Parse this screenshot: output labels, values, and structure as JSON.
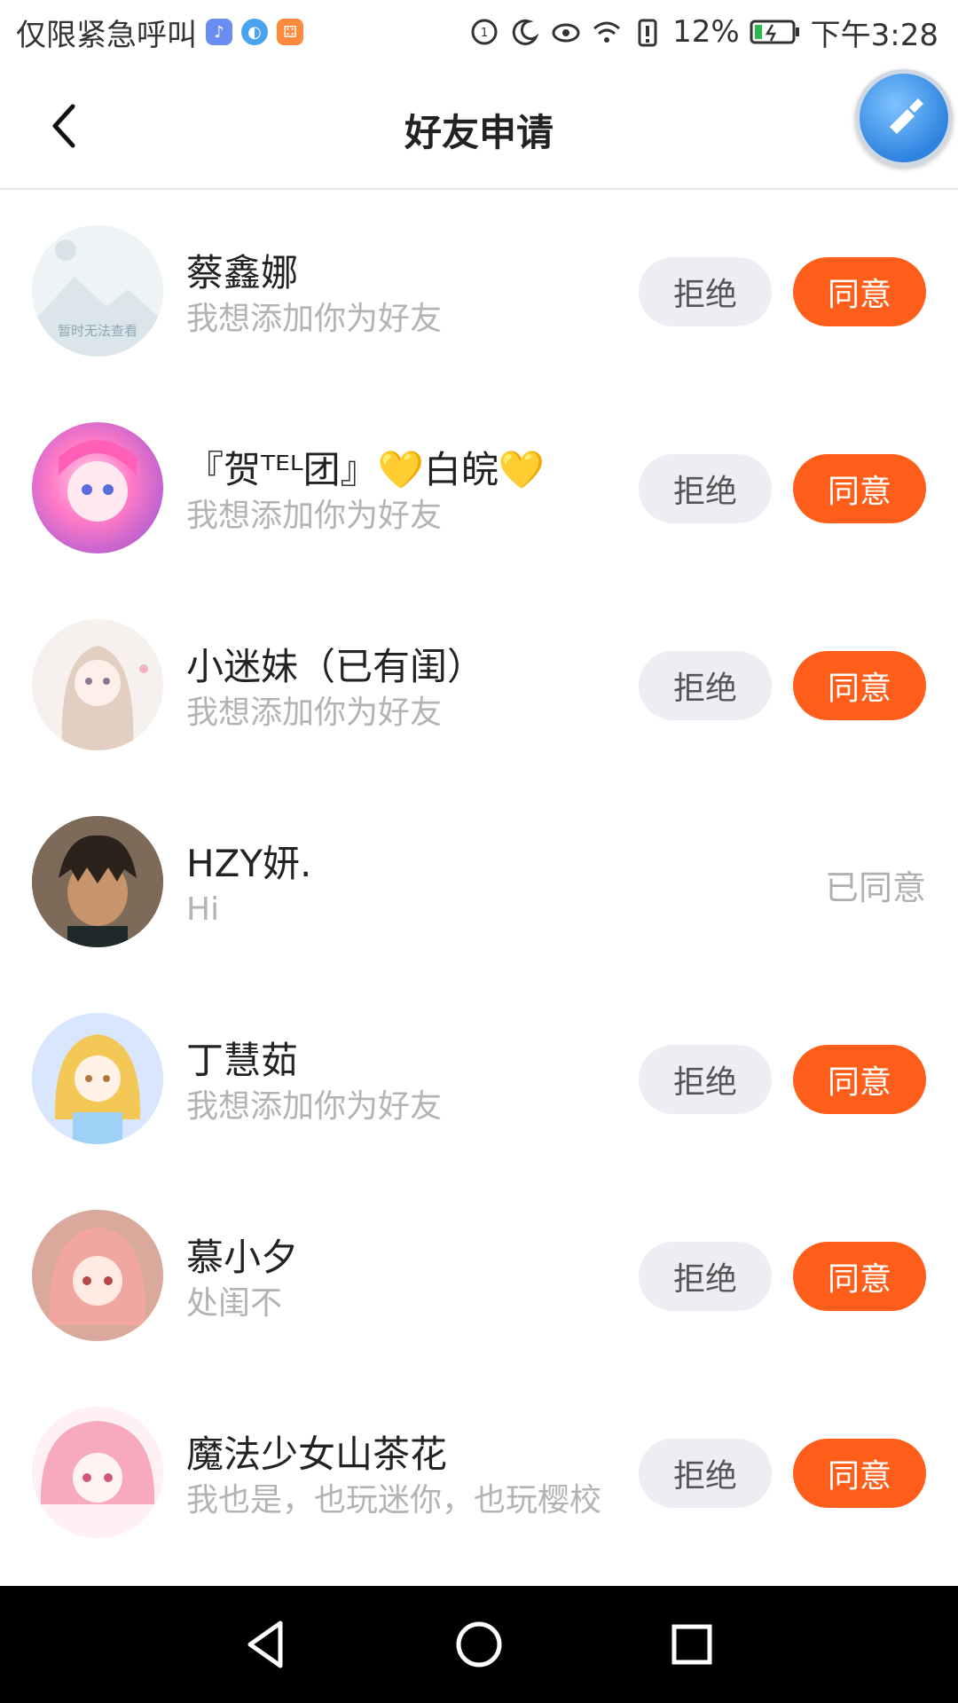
{
  "status_bar": {
    "carrier": "仅限紧急呼叫",
    "battery": "12%",
    "time": "下午3:28"
  },
  "header": {
    "title": "好友申请"
  },
  "labels": {
    "reject": "拒绝",
    "accept": "同意",
    "agreed": "已同意"
  },
  "requests": [
    {
      "name": "蔡鑫娜",
      "message": "我想添加你为好友",
      "status": "pending"
    },
    {
      "name": "『贺ᵀᴱᴸ团』💛白皖💛",
      "message": "我想添加你为好友",
      "status": "pending"
    },
    {
      "name": "小迷妹（已有闺）",
      "message": "我想添加你为好友",
      "status": "pending"
    },
    {
      "name": "HZY妍.",
      "message": "Hi",
      "status": "agreed"
    },
    {
      "name": "丁慧茹",
      "message": "我想添加你为好友",
      "status": "pending"
    },
    {
      "name": "慕小夕",
      "message": "处闺不",
      "status": "pending"
    },
    {
      "name": "魔法少女山茶花",
      "message": "我也是，也玩迷你，也玩樱校",
      "status": "pending"
    }
  ],
  "placeholder_avatar_text": "暂时无法查看",
  "colors": {
    "accent": "#ff5e1a",
    "reject_bg": "#eceef3",
    "muted_text": "#b3b3b3"
  }
}
